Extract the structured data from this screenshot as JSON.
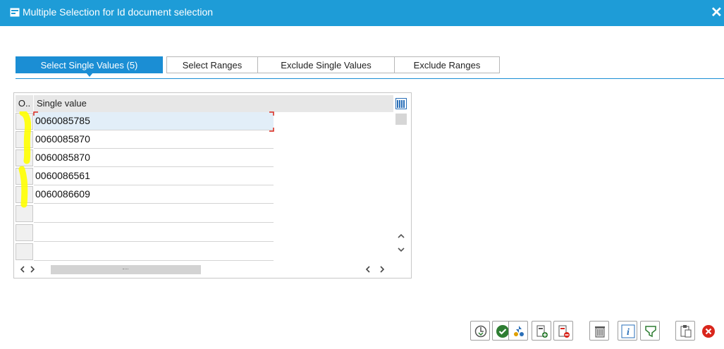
{
  "window": {
    "title": "Multiple Selection for Id document selection",
    "close_glyph": "✕"
  },
  "tabs": [
    {
      "label": "Select Single Values (5)",
      "active": true
    },
    {
      "label": "Select Ranges",
      "active": false
    },
    {
      "label": "Exclude Single Values",
      "active": false
    },
    {
      "label": "Exclude Ranges",
      "active": false
    }
  ],
  "table": {
    "col_option": "O..",
    "col_value": "Single value",
    "rows": [
      "0060085785",
      "0060085870",
      "0060085870",
      "0060086561",
      "0060086609",
      "",
      "",
      ""
    ]
  },
  "colors": {
    "titlebar": "#1e9cd7",
    "accent": "#1b8ed4",
    "highlight": "#ffff00",
    "error": "#d9261c",
    "ok": "#2e7d32"
  },
  "toolbar": {
    "buttons": [
      "execute-icon",
      "check-icon",
      "import-icon",
      "insert-row-icon",
      "delete-row-icon",
      "trash-icon",
      "info-icon",
      "filter-icon",
      "paste-icon",
      "cancel-icon"
    ]
  }
}
